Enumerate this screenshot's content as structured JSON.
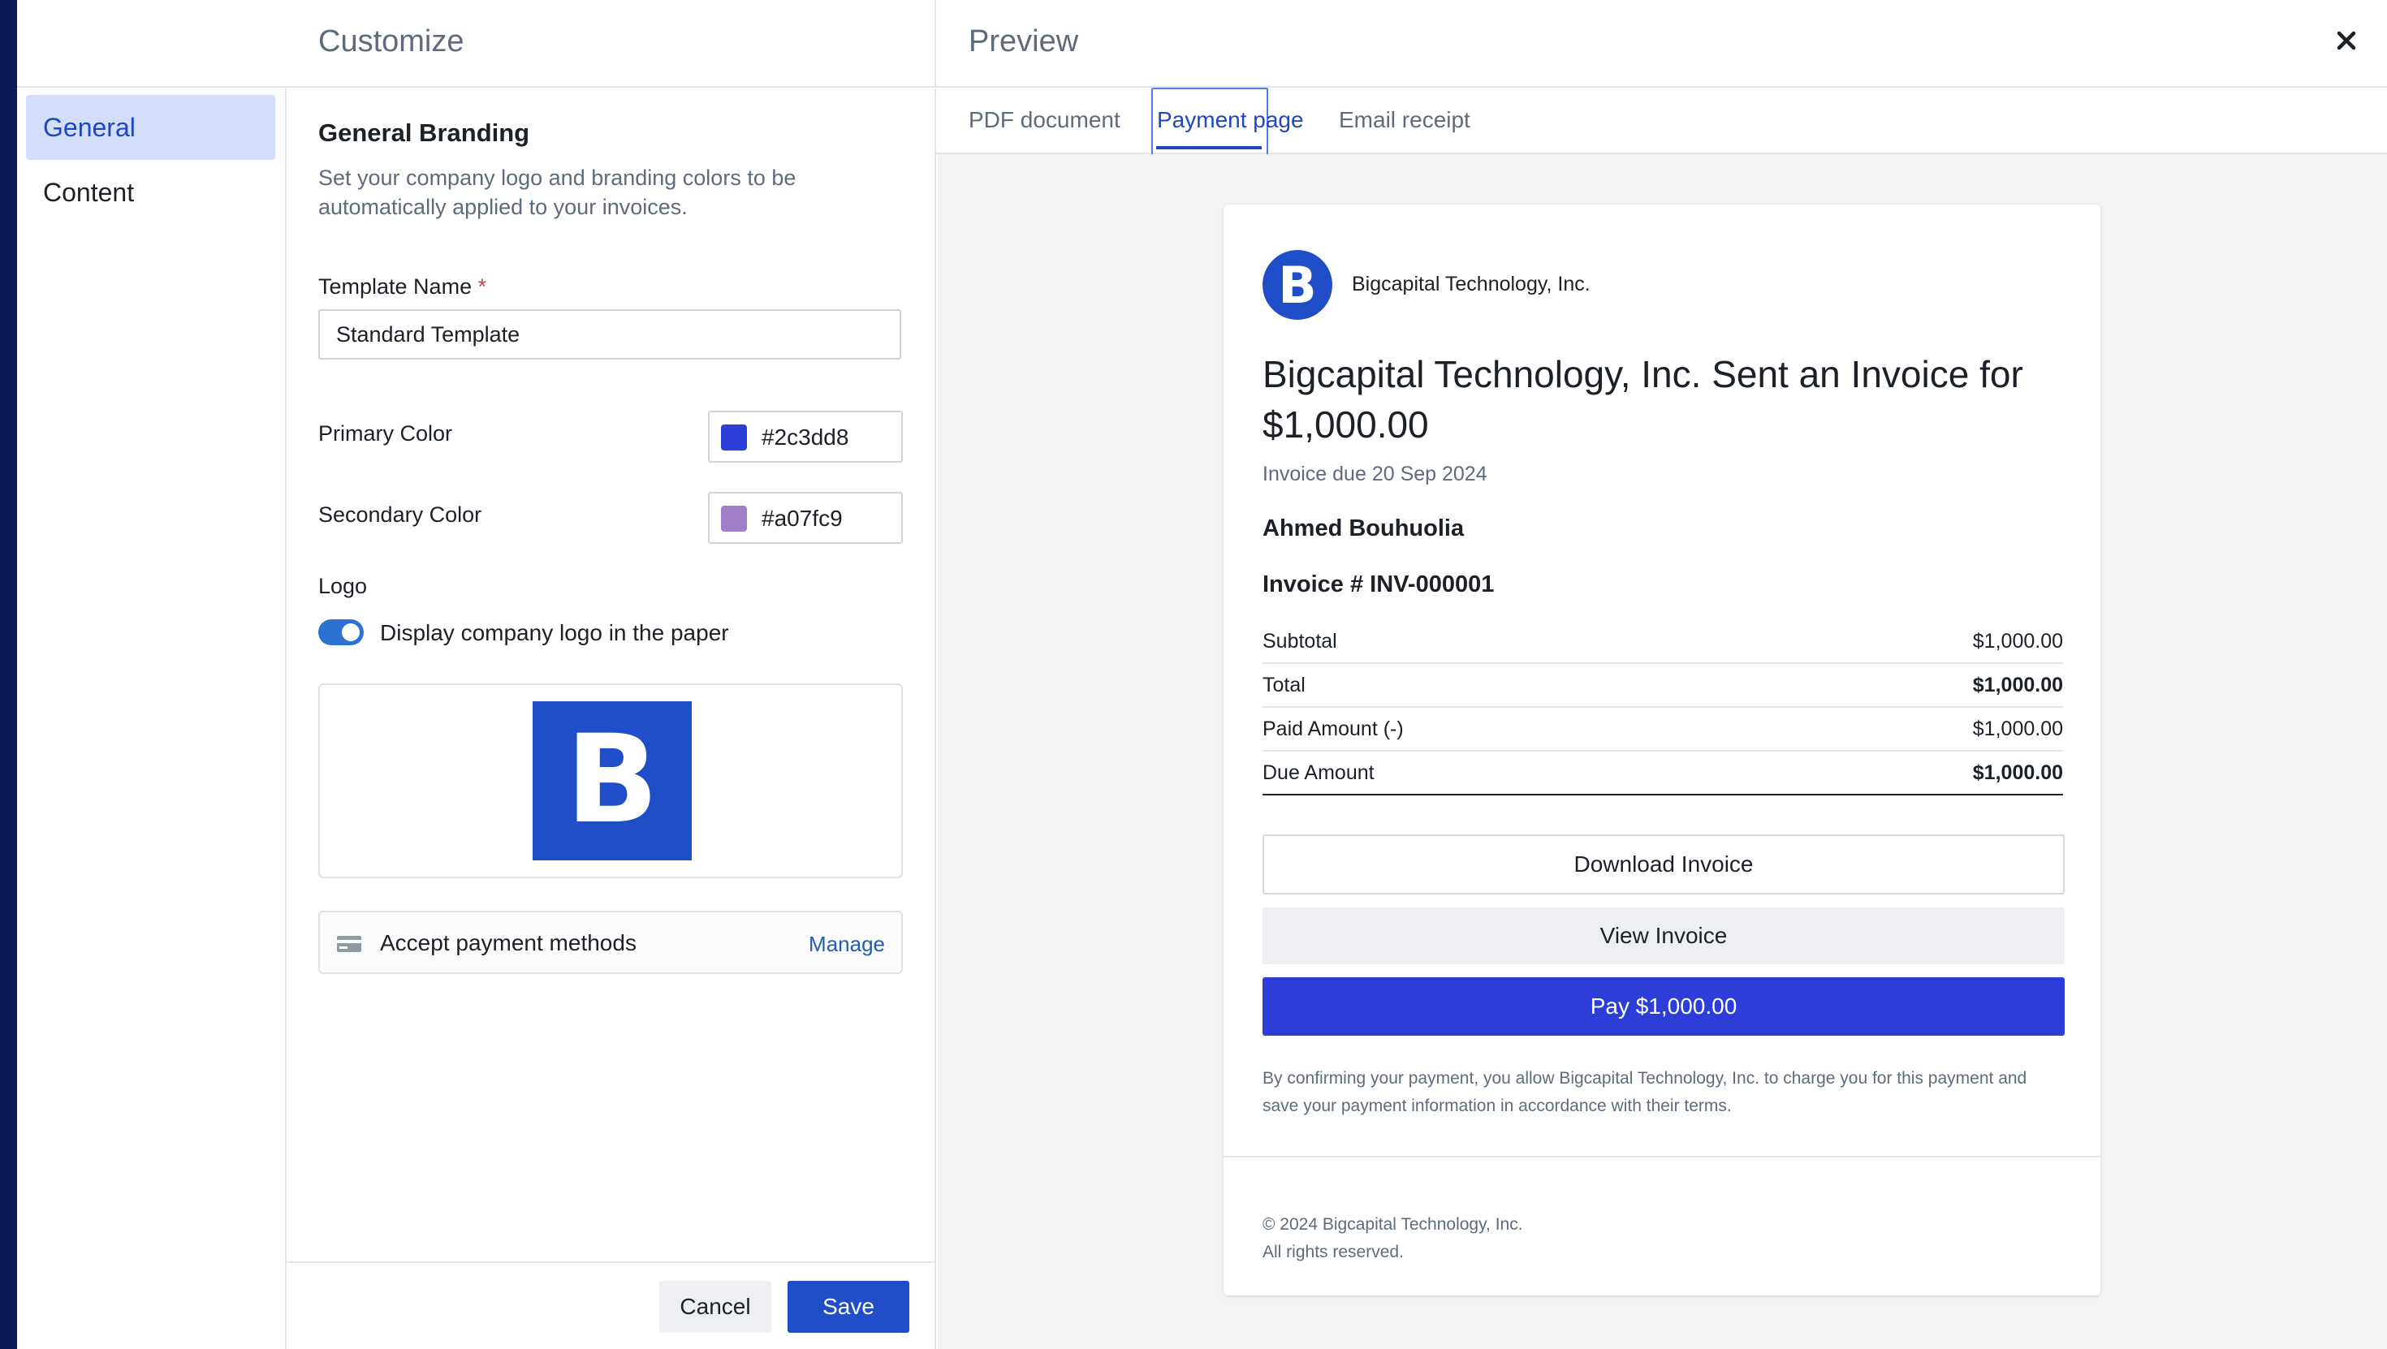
{
  "sidebar": {
    "items": [
      {
        "label": "General",
        "active": true
      },
      {
        "label": "Content",
        "active": false
      }
    ]
  },
  "header": {
    "customize_title": "Customize",
    "preview_title": "Preview"
  },
  "general": {
    "section_title": "General Branding",
    "section_desc": "Set your company logo and branding colors to be automatically applied to your invoices.",
    "template_name_label": "Template Name",
    "required_mark": "*",
    "template_name_value": "Standard Template",
    "primary_color_label": "Primary Color",
    "primary_color_value": "#2c3dd8",
    "secondary_color_label": "Secondary Color",
    "secondary_color_value": "#a07fc9",
    "logo_label": "Logo",
    "display_logo_label": "Display company logo in the paper",
    "display_logo_on": true,
    "logo_letter": "B",
    "payment_methods_label": "Accept payment methods",
    "manage_label": "Manage"
  },
  "footer": {
    "cancel_label": "Cancel",
    "save_label": "Save"
  },
  "preview": {
    "tabs": [
      {
        "label": "PDF document",
        "active": false
      },
      {
        "label": "Payment page",
        "active": true
      },
      {
        "label": "Email receipt",
        "active": false
      }
    ],
    "company_logo_letter": "B",
    "company_name": "Bigcapital Technology, Inc.",
    "heading": "Bigcapital Technology, Inc. Sent an Invoice for $1,000.00",
    "due_text": "Invoice due 20 Sep 2024",
    "customer_name": "Ahmed Bouhuolia",
    "invoice_number": "Invoice # INV-000001",
    "totals": [
      {
        "label": "Subtotal",
        "value": "$1,000.00"
      },
      {
        "label": "Total",
        "value": "$1,000.00"
      },
      {
        "label": "Paid Amount (-)",
        "value": "$1,000.00"
      },
      {
        "label": "Due Amount",
        "value": "$1,000.00"
      }
    ],
    "download_label": "Download Invoice",
    "view_label": "View Invoice",
    "pay_label": "Pay $1,000.00",
    "consent_text": "By confirming your payment, you allow Bigcapital Technology, Inc. to charge you for this payment and save your payment information in accordance with their terms.",
    "copyright": "© 2024 Bigcapital Technology, Inc.",
    "rights": "All rights reserved."
  },
  "colors": {
    "brand_blue": "#1f4ec8",
    "primary": "#2c3dd8",
    "secondary": "#a07fc9",
    "accent_text": "#1f47c2"
  },
  "icons": [
    "close-icon",
    "credit-card-icon",
    "company-logo"
  ]
}
